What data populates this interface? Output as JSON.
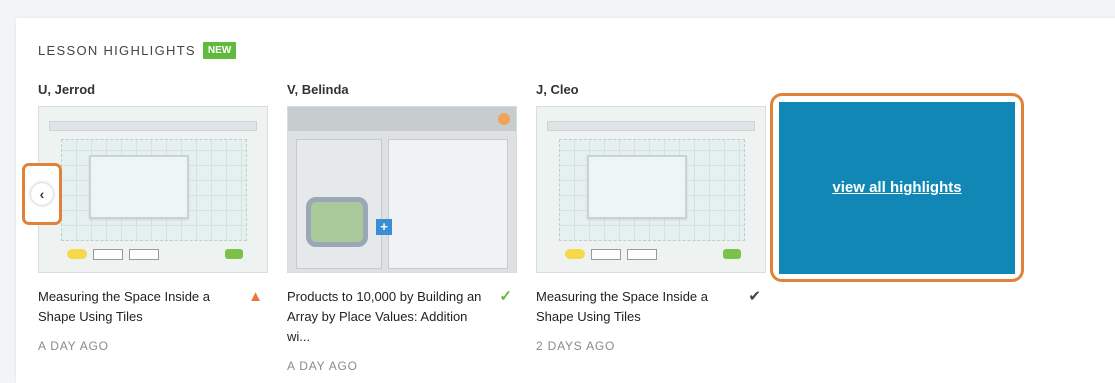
{
  "section": {
    "title": "LESSON HIGHLIGHTS",
    "badge": "NEW"
  },
  "cards": [
    {
      "student": "U, Jerrod",
      "title": "Measuring the Space Inside a Shape Using Tiles",
      "time": "A DAY AGO",
      "status_icon": "warning-icon"
    },
    {
      "student": "V, Belinda",
      "title": "Products to 10,000 by Building an Array by Place Values: Addition wi...",
      "time": "A DAY AGO",
      "status_icon": "checkmark-icon"
    },
    {
      "student": "J, Cleo",
      "title": "Measuring the Space Inside a Shape Using Tiles",
      "time": "2 DAYS AGO",
      "status_icon": "circle-check-icon"
    }
  ],
  "view_all": {
    "label": "view all highlights"
  },
  "colors": {
    "accent": "#1087b5",
    "highlight_outline": "#e0823a",
    "badge": "#5fba3e"
  },
  "nav": {
    "prev_icon": "chevron-left-icon"
  }
}
